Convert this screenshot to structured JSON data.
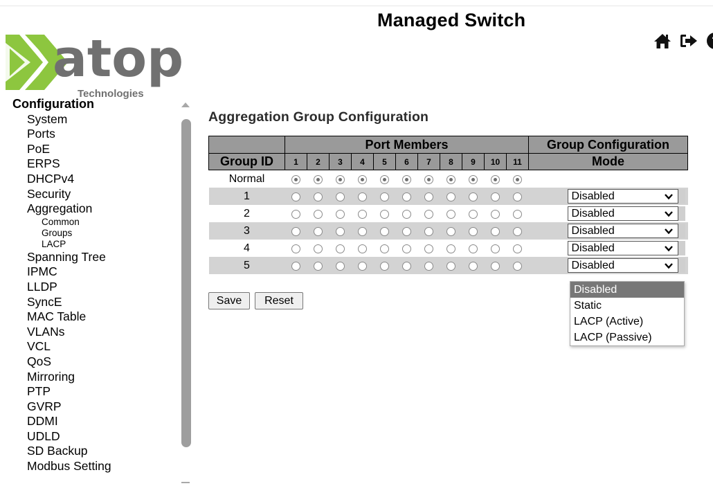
{
  "app": {
    "title": "Managed Switch",
    "logo_text": "atop",
    "logo_sub": "Technologies"
  },
  "colors": {
    "logo_green": "#8DC63F",
    "logo_gray": "#707070",
    "header_bg": "#9a9a9a",
    "row_alt": "#d3d3d3",
    "dropdown_selected": "#777777"
  },
  "header_icons": [
    "home-icon",
    "logout-icon",
    "help-icon"
  ],
  "sidebar": {
    "heading": "Configuration",
    "items": [
      "System",
      "Ports",
      "PoE",
      "ERPS",
      "DHCPv4",
      "Security",
      "Aggregation"
    ],
    "aggregation_sub": [
      "Common",
      "Groups",
      "LACP"
    ],
    "items_after": [
      "Spanning Tree",
      "IPMC",
      "LLDP",
      "SyncE",
      "MAC Table",
      "VLANs",
      "VCL",
      "QoS",
      "Mirroring",
      "PTP",
      "GVRP",
      "DDMI",
      "UDLD",
      "SD Backup",
      "Modbus Setting"
    ]
  },
  "main": {
    "title": "Aggregation Group Configuration",
    "table": {
      "port_members_header": "Port Members",
      "group_config_header": "Group Configuration",
      "group_id_header": "Group ID",
      "mode_header": "Mode",
      "ports": [
        "1",
        "2",
        "3",
        "4",
        "5",
        "6",
        "7",
        "8",
        "9",
        "10",
        "11"
      ],
      "normal_row_label": "Normal",
      "rows": [
        {
          "id": "1",
          "mode": "Disabled"
        },
        {
          "id": "2",
          "mode": "Disabled"
        },
        {
          "id": "3",
          "mode": "Disabled"
        },
        {
          "id": "4",
          "mode": "Disabled"
        },
        {
          "id": "5",
          "mode": "Disabled"
        }
      ]
    },
    "save_label": "Save",
    "reset_label": "Reset"
  },
  "mode_dropdown": {
    "options": [
      "Disabled",
      "Static",
      "LACP (Active)",
      "LACP (Passive)"
    ],
    "selected": "Disabled"
  }
}
